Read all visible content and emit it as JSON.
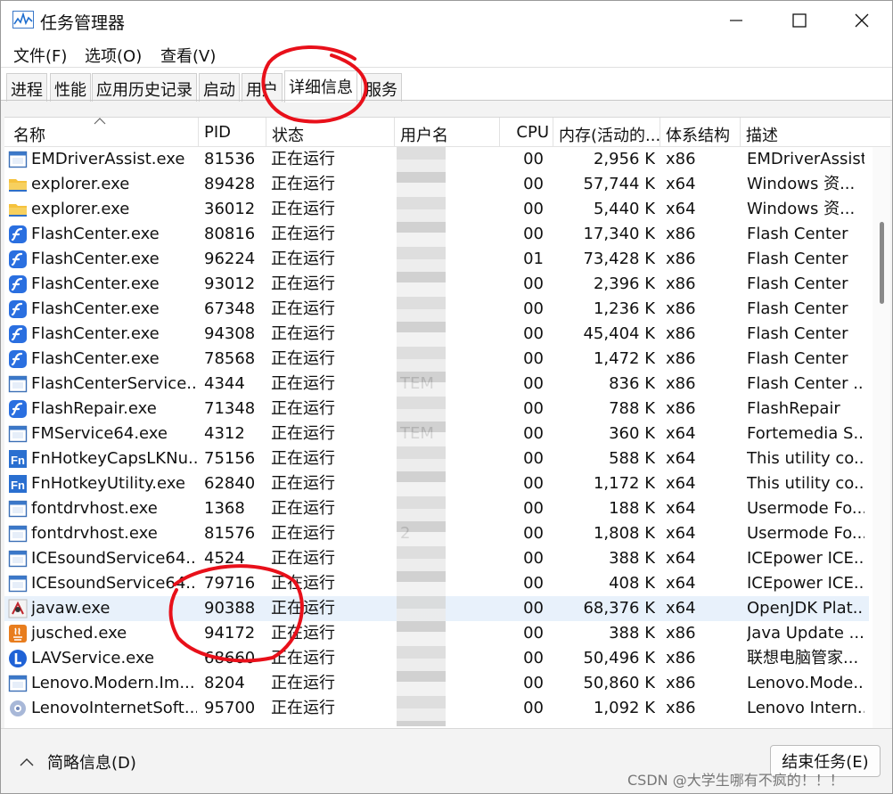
{
  "window": {
    "title": "任务管理器"
  },
  "menu": [
    "文件(F)",
    "选项(O)",
    "查看(V)"
  ],
  "tabs": [
    "进程",
    "性能",
    "应用历史记录",
    "启动",
    "用户",
    "详细信息",
    "服务"
  ],
  "active_tab": "详细信息",
  "columns": [
    "名称",
    "PID",
    "状态",
    "用户名",
    "CPU",
    "内存(活动的...",
    "体系结构",
    "描述"
  ],
  "rows": [
    {
      "name": "EMDriverAssist.exe",
      "pid": "81536",
      "status": "正在运行",
      "user": "",
      "cpu": "00",
      "mem": "2,956 K",
      "arch": "x86",
      "desc": "EMDriverAssist",
      "icon": "window-icon"
    },
    {
      "name": "explorer.exe",
      "pid": "89428",
      "status": "正在运行",
      "user": "",
      "cpu": "00",
      "mem": "57,744 K",
      "arch": "x64",
      "desc": "Windows 资...",
      "icon": "folder-icon"
    },
    {
      "name": "explorer.exe",
      "pid": "36012",
      "status": "正在运行",
      "user": "",
      "cpu": "00",
      "mem": "5,440 K",
      "arch": "x64",
      "desc": "Windows 资...",
      "icon": "folder-icon"
    },
    {
      "name": "FlashCenter.exe",
      "pid": "80816",
      "status": "正在运行",
      "user": "",
      "cpu": "00",
      "mem": "17,340 K",
      "arch": "x86",
      "desc": "Flash Center",
      "icon": "flash-icon"
    },
    {
      "name": "FlashCenter.exe",
      "pid": "96224",
      "status": "正在运行",
      "user": "",
      "cpu": "01",
      "mem": "73,428 K",
      "arch": "x86",
      "desc": "Flash Center",
      "icon": "flash-icon"
    },
    {
      "name": "FlashCenter.exe",
      "pid": "93012",
      "status": "正在运行",
      "user": "",
      "cpu": "00",
      "mem": "2,396 K",
      "arch": "x86",
      "desc": "Flash Center",
      "icon": "flash-icon"
    },
    {
      "name": "FlashCenter.exe",
      "pid": "67348",
      "status": "正在运行",
      "user": "",
      "cpu": "00",
      "mem": "1,236 K",
      "arch": "x86",
      "desc": "Flash Center",
      "icon": "flash-icon"
    },
    {
      "name": "FlashCenter.exe",
      "pid": "94308",
      "status": "正在运行",
      "user": "",
      "cpu": "00",
      "mem": "45,404 K",
      "arch": "x86",
      "desc": "Flash Center",
      "icon": "flash-icon"
    },
    {
      "name": "FlashCenter.exe",
      "pid": "78568",
      "status": "正在运行",
      "user": "",
      "cpu": "00",
      "mem": "1,472 K",
      "arch": "x86",
      "desc": "Flash Center",
      "icon": "flash-icon"
    },
    {
      "name": "FlashCenterService....",
      "pid": "4344",
      "status": "正在运行",
      "user": "TEM",
      "cpu": "00",
      "mem": "836 K",
      "arch": "x86",
      "desc": "Flash Center ...",
      "icon": "window-icon"
    },
    {
      "name": "FlashRepair.exe",
      "pid": "71348",
      "status": "正在运行",
      "user": "",
      "cpu": "00",
      "mem": "788 K",
      "arch": "x86",
      "desc": "FlashRepair",
      "icon": "flash-icon"
    },
    {
      "name": "FMService64.exe",
      "pid": "4312",
      "status": "正在运行",
      "user": "TEM",
      "cpu": "00",
      "mem": "360 K",
      "arch": "x64",
      "desc": "Fortemedia S...",
      "icon": "window-icon"
    },
    {
      "name": "FnHotkeyCapsLKNu...",
      "pid": "75156",
      "status": "正在运行",
      "user": "",
      "cpu": "00",
      "mem": "588 K",
      "arch": "x64",
      "desc": "This utility co...",
      "icon": "fn-icon"
    },
    {
      "name": "FnHotkeyUtility.exe",
      "pid": "62840",
      "status": "正在运行",
      "user": "",
      "cpu": "00",
      "mem": "1,172 K",
      "arch": "x64",
      "desc": "This utility co...",
      "icon": "fn-icon"
    },
    {
      "name": "fontdrvhost.exe",
      "pid": "1368",
      "status": "正在运行",
      "user": "",
      "cpu": "00",
      "mem": "188 K",
      "arch": "x64",
      "desc": "Usermode Fo...",
      "icon": "window-icon"
    },
    {
      "name": "fontdrvhost.exe",
      "pid": "81576",
      "status": "正在运行",
      "user": "2",
      "cpu": "00",
      "mem": "1,808 K",
      "arch": "x64",
      "desc": "Usermode Fo...",
      "icon": "window-icon"
    },
    {
      "name": "ICEsoundService64....",
      "pid": "4524",
      "status": "正在运行",
      "user": "",
      "cpu": "00",
      "mem": "388 K",
      "arch": "x64",
      "desc": "ICEpower ICE...",
      "icon": "window-icon"
    },
    {
      "name": "ICEsoundService64....",
      "pid": "79716",
      "status": "正在运行",
      "user": "",
      "cpu": "00",
      "mem": "408 K",
      "arch": "x64",
      "desc": "ICEpower ICE...",
      "icon": "window-icon"
    },
    {
      "name": "javaw.exe",
      "pid": "90388",
      "status": "正在运行",
      "user": "",
      "cpu": "00",
      "mem": "68,376 K",
      "arch": "x64",
      "desc": "OpenJDK Plat...",
      "icon": "java-icon",
      "selected": true
    },
    {
      "name": "jusched.exe",
      "pid": "94172",
      "status": "正在运行",
      "user": "",
      "cpu": "00",
      "mem": "388 K",
      "arch": "x86",
      "desc": "Java Update ...",
      "icon": "java-update-icon"
    },
    {
      "name": "LAVService.exe",
      "pid": "68660",
      "status": "正在运行",
      "user": "",
      "cpu": "00",
      "mem": "50,496 K",
      "arch": "x86",
      "desc": "联想电脑管家...",
      "icon": "lenovo-icon"
    },
    {
      "name": "Lenovo.Modern.Im...",
      "pid": "8204",
      "status": "正在运行",
      "user": "",
      "cpu": "00",
      "mem": "50,860 K",
      "arch": "x86",
      "desc": "Lenovo.Mode...",
      "icon": "window-icon"
    },
    {
      "name": "LenovoInternetSoft...",
      "pid": "95700",
      "status": "正在运行",
      "user": "",
      "cpu": "00",
      "mem": "1,092 K",
      "arch": "x86",
      "desc": "Lenovo Intern...",
      "icon": "gear-icon"
    }
  ],
  "footer": {
    "fewer_details": "简略信息(D)",
    "end_task": "结束任务(E)"
  },
  "watermark": "CSDN @大学生哪有不疯的！！！",
  "colors": {
    "selected_row": "#e8f1fb",
    "annotation_red": "#e8101a"
  }
}
